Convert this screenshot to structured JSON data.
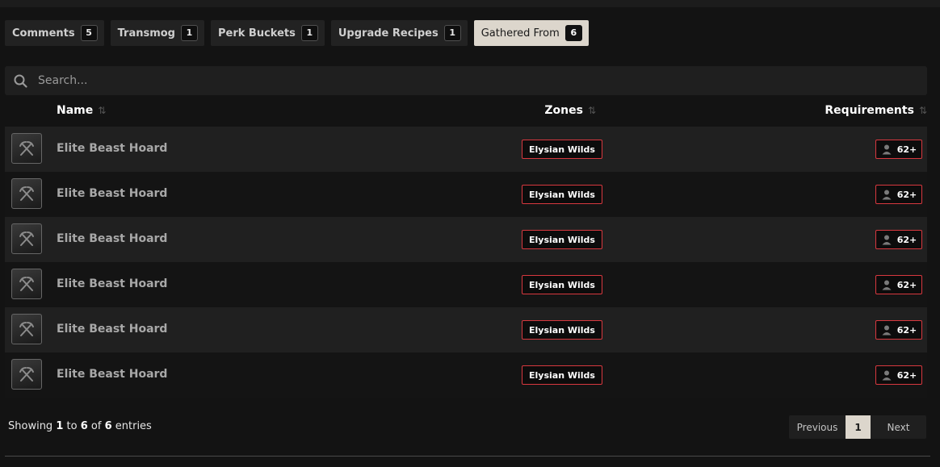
{
  "tabs": [
    {
      "label": "Comments",
      "count": "5",
      "active": false
    },
    {
      "label": "Transmog",
      "count": "1",
      "active": false
    },
    {
      "label": "Perk Buckets",
      "count": "1",
      "active": false
    },
    {
      "label": "Upgrade Recipes",
      "count": "1",
      "active": false
    },
    {
      "label": "Gathered From",
      "count": "6",
      "active": true
    }
  ],
  "search": {
    "placeholder": "Search...",
    "icon": "search-icon"
  },
  "table": {
    "columns": {
      "name": "Name",
      "zones": "Zones",
      "requirements": "Requirements"
    },
    "rows": [
      {
        "name": "Elite Beast Hoard",
        "zone": "Elysian Wilds",
        "requirement": "62+",
        "icon": "crossed-pickaxes-icon"
      },
      {
        "name": "Elite Beast Hoard",
        "zone": "Elysian Wilds",
        "requirement": "62+",
        "icon": "crossed-pickaxes-icon"
      },
      {
        "name": "Elite Beast Hoard",
        "zone": "Elysian Wilds",
        "requirement": "62+",
        "icon": "crossed-pickaxes-icon"
      },
      {
        "name": "Elite Beast Hoard",
        "zone": "Elysian Wilds",
        "requirement": "62+",
        "icon": "crossed-pickaxes-icon"
      },
      {
        "name": "Elite Beast Hoard",
        "zone": "Elysian Wilds",
        "requirement": "62+",
        "icon": "crossed-pickaxes-icon"
      },
      {
        "name": "Elite Beast Hoard",
        "zone": "Elysian Wilds",
        "requirement": "62+",
        "icon": "crossed-pickaxes-icon"
      }
    ]
  },
  "info": {
    "prefix": "Showing",
    "from": "1",
    "to_word": "to",
    "to": "6",
    "of_word": "of",
    "total": "6",
    "suffix": "entries"
  },
  "pagination": {
    "previous": "Previous",
    "current": "1",
    "next": "Next"
  },
  "colors": {
    "accent_red": "#d8383f",
    "active_tab_bg": "#dcd6cc",
    "background": "#131313"
  }
}
